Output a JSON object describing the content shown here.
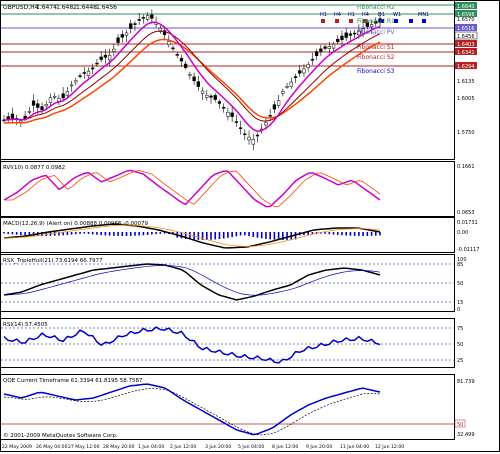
{
  "main": {
    "title": "GBPUSD,H4",
    "ohlc": [
      "1.6474",
      "1.6482",
      "1.6448",
      "1.6456"
    ],
    "fib_labels": [
      "Fibonacci  R2",
      "Fibonacci  R1",
      "Fibonacci  PV",
      "Fibonacci  S1",
      "Fibonacci  S2",
      "Fibonacci  S3"
    ],
    "period_labels": [
      "H1",
      "H4",
      "H1",
      "H4",
      "D1",
      "W1",
      "MN1"
    ],
    "price_ticks": [
      "1.6570",
      "1.6456",
      "1.6135",
      "1.6005",
      "1.5750"
    ],
    "price_boxes": [
      {
        "text": "1.6640",
        "color": "#2e8b57"
      },
      {
        "text": "1.6598",
        "color": "#2e8b57"
      },
      {
        "text": "1.6516",
        "color": "#6a5acd"
      },
      {
        "text": "1.6456",
        "color": "#ffffff"
      },
      {
        "text": "1.6403",
        "color": "#b22222"
      },
      {
        "text": "1.6341",
        "color": "#b22222"
      },
      {
        "text": "1.6294",
        "color": "#b22222"
      }
    ],
    "colors": {
      "up": "#ffffff",
      "down": "#000000",
      "ma_fast": "#cc00cc",
      "ma_slow": "#ff4500",
      "ma_mid": "#8b0000"
    }
  },
  "rvi": {
    "label": "RVI(10) 0.0877 0.0982",
    "ticks": [
      "0.1661",
      "0.0653"
    ]
  },
  "macd": {
    "label": "MACD(12,26,9) (Alert on) 0.00888 0.00966 -0.00079",
    "ticks": [
      "0.01731",
      "0.00",
      "-0.01117"
    ]
  },
  "rsx": {
    "label": "RSX_TripleHull(21) 73.6194 66.7977",
    "ticks": [
      "100",
      "85",
      "50",
      "15",
      "0"
    ]
  },
  "rsi": {
    "label": "RSI(14) 57.4505",
    "ticks": [
      "75",
      "50",
      "25"
    ]
  },
  "qqe": {
    "label": "QQE Current Timeframe 61.3394 61.8195 58.7587",
    "ticks": [
      "81.739",
      "50",
      "32.499"
    ]
  },
  "copyright": "© 2001-2009 MetaQuotes Software Corp.",
  "time_axis": [
    "22 May 2009",
    "26 May 04:00",
    "27 May 12:00",
    "28 May 20:00",
    "1 Jun 04:00",
    "2 Jun 12:00",
    "3 Jun 20:00",
    "5 Jun 04:00",
    "8 Jun 12:00",
    "9 Jun 20:00",
    "11 Jun 04:00",
    "12 Jun 12:00"
  ]
}
